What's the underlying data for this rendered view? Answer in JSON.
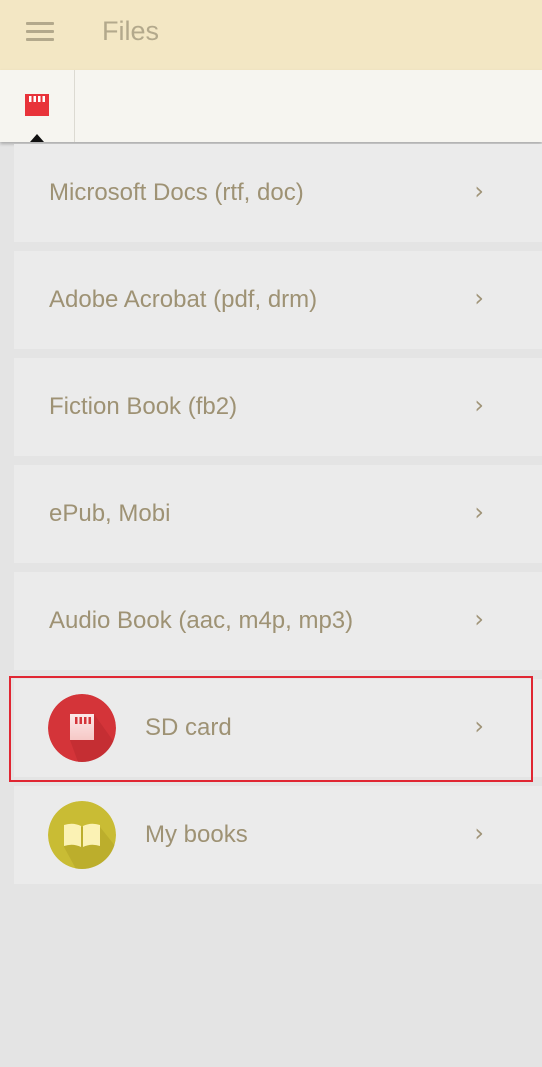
{
  "appbar": {
    "title": "Files",
    "menu_icon": "hamburger-menu-icon"
  },
  "tabs": [
    {
      "icon": "sd-card-icon",
      "color": "#e8333a",
      "active": true
    }
  ],
  "list": {
    "items": [
      {
        "label": "Microsoft Docs (rtf, doc)",
        "chevron": "›"
      },
      {
        "label": "Adobe Acrobat (pdf, drm)",
        "chevron": "›"
      },
      {
        "label": "Fiction Book (fb2)",
        "chevron": "›"
      },
      {
        "label": "ePub, Mobi",
        "chevron": "›"
      },
      {
        "label": "Audio Book (aac, m4p, mp3)",
        "chevron": "›"
      },
      {
        "label": "SD card",
        "chevron": "›",
        "icon": "sd-card-icon",
        "icon_color": "#d43439",
        "highlighted": true
      },
      {
        "label": "My books",
        "chevron": "›",
        "icon": "open-book-icon",
        "icon_color": "#c9bc34"
      }
    ]
  },
  "colors": {
    "appbar_bg": "#f3e7c4",
    "text": "#9e9274",
    "highlight_border": "#e02632",
    "background": "#e4e4e4"
  }
}
